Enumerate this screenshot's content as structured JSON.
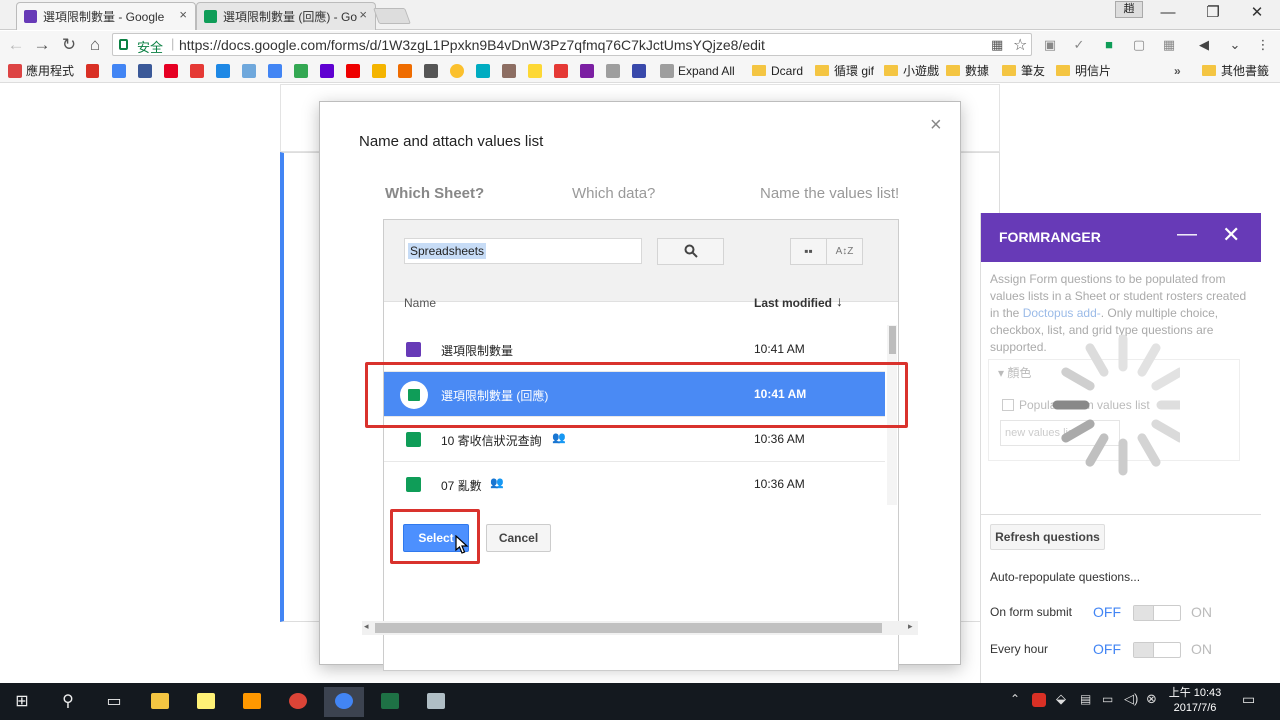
{
  "browser": {
    "tabs": [
      {
        "title": "選項限制數量 - Google",
        "active": true,
        "icon_color": "#673ab7"
      },
      {
        "title": "選項限制數量 (回應) - Go",
        "active": false,
        "icon_color": "#0f9d58"
      }
    ],
    "user_badge": "趙",
    "secure_label": "安全",
    "url": "https://docs.google.com/forms/d/1W3zgL1Ppxkn9B4vDnW3Pz7qfmq76C7kJctUmsYQjze8/edit",
    "bookmarks": [
      "應用程式",
      "Expand All",
      "Dcard",
      "循環 gif",
      "小遊戲",
      "數據",
      "筆友",
      "明信片",
      "其他書籤"
    ]
  },
  "dialog": {
    "title": "Name and attach values list",
    "close_icon": "×",
    "steps": [
      "Which Sheet?",
      "Which data?",
      "Name the values list!"
    ]
  },
  "picker": {
    "search_value": "Spreadsheets",
    "columns": {
      "name": "Name",
      "modified": "Last modified"
    },
    "rows": [
      {
        "name": "選項限制數量",
        "time": "10:41 AM",
        "type": "form",
        "shared": false
      },
      {
        "name": "選項限制數量 (回應)",
        "time": "10:41 AM",
        "type": "sheet",
        "shared": false,
        "selected": true
      },
      {
        "name": "10 寄收信狀況查詢",
        "time": "10:36 AM",
        "type": "sheet",
        "shared": true
      },
      {
        "name": "07 亂數",
        "time": "10:36 AM",
        "type": "sheet",
        "shared": true
      }
    ],
    "select_label": "Select",
    "cancel_label": "Cancel"
  },
  "sidebar": {
    "title": "FORMRANGER",
    "desc_pre": "Assign Form questions to be populated from values lists in a Sheet or student rosters created in the ",
    "desc_link": "Doctopus add-",
    "desc_post": ". Only multiple choice, checkbox, list, and grid type questions are supported.",
    "question_label": "顏色",
    "populate_label": "Populate from values list",
    "new_list_placeholder": "new values list",
    "refresh_label": "Refresh questions",
    "auto_label": "Auto-repopulate questions...",
    "toggles": [
      {
        "label": "On form submit",
        "off": "OFF",
        "on": "ON"
      },
      {
        "label": "Every hour",
        "off": "OFF",
        "on": "ON"
      }
    ]
  },
  "taskbar": {
    "time": "上午 10:43",
    "date": "2017/7/6"
  },
  "colors": {
    "accent": "#4a8af4",
    "sidebar_header": "#673ab7",
    "highlight": "#d9322d",
    "sheet_green": "#0f9d58",
    "form_purple": "#673ab7"
  }
}
